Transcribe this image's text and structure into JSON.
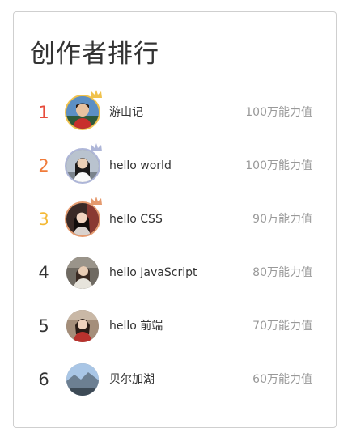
{
  "title": "创作者排行",
  "colors": {
    "rank_1": "#e74c3c",
    "rank_2": "#f07b3a",
    "rank_3": "#f4b935",
    "rank_default": "#333333",
    "gold": "#f0c24d",
    "silver": "#aeb6d8",
    "bronze": "#e59a6e"
  },
  "creators": [
    {
      "rank": "1",
      "name": "游山记",
      "score": "100万能力值",
      "medal": "gold-crown-icon"
    },
    {
      "rank": "2",
      "name": "hello world",
      "score": "100万能力值",
      "medal": "silver-crown-icon"
    },
    {
      "rank": "3",
      "name": "hello CSS",
      "score": "90万能力值",
      "medal": "bronze-crown-icon"
    },
    {
      "rank": "4",
      "name": "hello JavaScript",
      "score": "80万能力值"
    },
    {
      "rank": "5",
      "name": "hello 前端",
      "score": "70万能力值"
    },
    {
      "rank": "6",
      "name": "贝尔加湖",
      "score": "60万能力值"
    }
  ]
}
